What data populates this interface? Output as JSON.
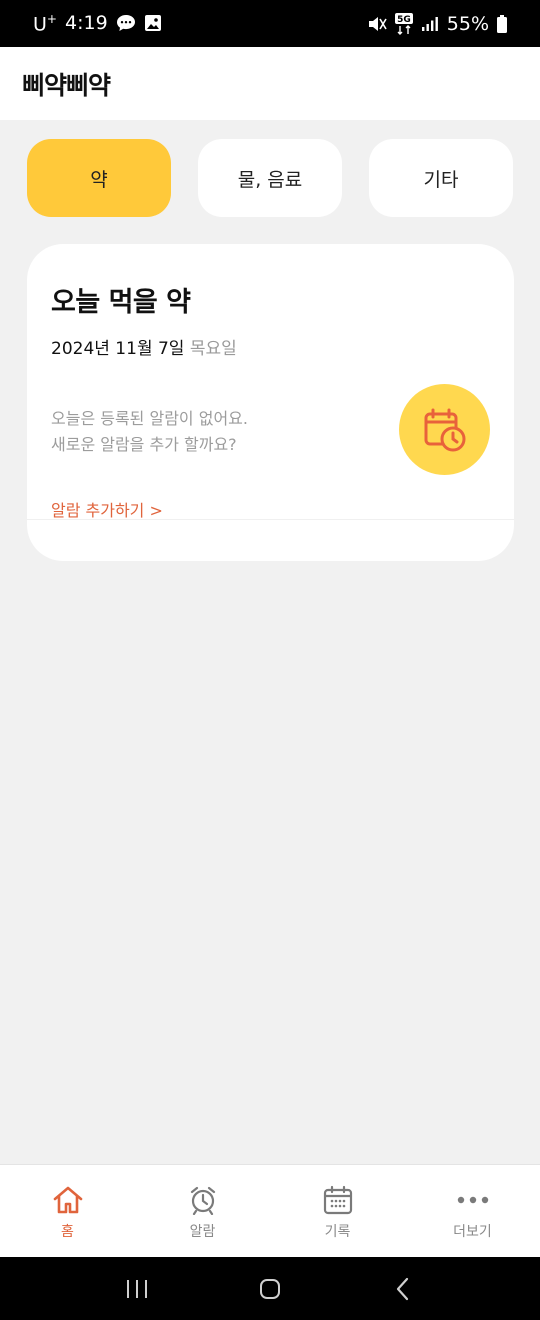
{
  "status_bar": {
    "carrier": "U",
    "carrier_sup": "+",
    "time": "4:19",
    "battery": "55%",
    "network": "5G"
  },
  "app": {
    "title": "삐약삐약"
  },
  "tabs": [
    {
      "label": "약",
      "active": true
    },
    {
      "label": "물, 음료",
      "active": false
    },
    {
      "label": "기타",
      "active": false
    }
  ],
  "card": {
    "title": "오늘 먹을 약",
    "date": "2024년 11월 7일",
    "weekday": "목요일",
    "message_line1": "오늘은 등록된 알람이 없어요.",
    "message_line2": "새로운 알람을 추가 할까요?",
    "link": "알람 추가하기 >",
    "badge_icon": "calendar-clock-icon"
  },
  "bottom_nav": [
    {
      "label": "홈",
      "icon": "home-icon",
      "active": true
    },
    {
      "label": "알람",
      "icon": "alarm-clock-icon",
      "active": false
    },
    {
      "label": "기록",
      "icon": "calendar-icon",
      "active": false
    },
    {
      "label": "더보기",
      "icon": "more-icon",
      "active": false
    }
  ],
  "colors": {
    "accent": "#ffc93a",
    "link": "#e0643c",
    "badge": "#ffd84f",
    "background": "#f1f1f1"
  }
}
